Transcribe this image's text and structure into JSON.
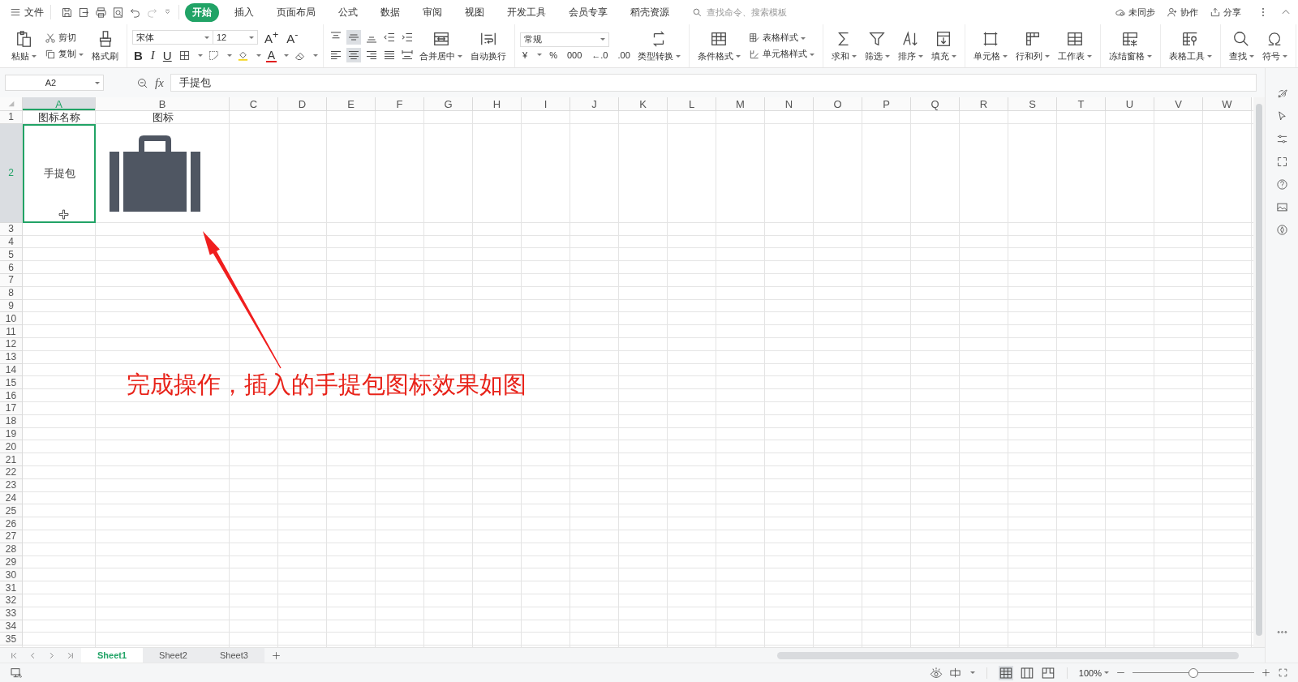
{
  "menu_bar": {
    "file_label": "文件",
    "tabs": [
      {
        "label": "开始",
        "selected": true
      },
      {
        "label": "插入",
        "selected": false
      },
      {
        "label": "页面布局",
        "selected": false
      },
      {
        "label": "公式",
        "selected": false
      },
      {
        "label": "数据",
        "selected": false
      },
      {
        "label": "审阅",
        "selected": false
      },
      {
        "label": "视图",
        "selected": false
      },
      {
        "label": "开发工具",
        "selected": false
      },
      {
        "label": "会员专享",
        "selected": false
      },
      {
        "label": "稻壳资源",
        "selected": false
      }
    ],
    "search": {
      "placeholder": "查找命令、搜索模板"
    },
    "actions": [
      "未同步",
      "协作",
      "分享"
    ]
  },
  "ribbon": {
    "groups": [
      [
        {
          "kind": "large",
          "label": "粘贴",
          "dropdown": true
        },
        {
          "kind": "stack",
          "items": [
            {
              "label": "剪切",
              "dropdown": false
            },
            {
              "label": "复制",
              "dropdown": true
            }
          ]
        },
        {
          "kind": "large",
          "label": "格式刷",
          "dropdown": false
        }
      ],
      [
        {
          "kind": "font",
          "name": "宋体",
          "size": "12",
          "grow": "A$^{+}$",
          "shrink": "A$^{-}$",
          "styles": [
            "B",
            "I",
            "U"
          ],
          "color_label": "A"
        }
      ],
      [
        {
          "kind": "align",
          "top": [
            {
              "selected": false
            },
            {
              "selected": true
            },
            {
              "selected": false
            },
            {
              "selected": false
            },
            {
              "selected": false
            }
          ],
          "bottom": [
            {
              "selected": false
            },
            {
              "selected": true
            },
            {
              "selected": false
            },
            {
              "selected": false
            },
            {
              "selected": false
            }
          ]
        },
        {
          "kind": "large",
          "label": "合并居中",
          "dropdown": true
        },
        {
          "kind": "large",
          "label": "自动换行",
          "dropdown": false
        }
      ],
      [
        {
          "kind": "number",
          "format": "常规",
          "buttons": [
            "¥",
            "%",
            "000",
            "←.0",
            ".00"
          ]
        },
        {
          "kind": "large",
          "label": "类型转换",
          "dropdown": true
        }
      ],
      [
        {
          "kind": "large",
          "label": "条件格式",
          "dropdown": true
        },
        {
          "kind": "stack",
          "items": [
            {
              "label": "表格样式",
              "dropdown": true
            },
            {
              "label": "单元格样式",
              "dropdown": true
            }
          ]
        }
      ],
      [
        {
          "kind": "large",
          "label": "求和",
          "dropdown": true
        },
        {
          "kind": "large",
          "label": "筛选",
          "dropdown": true
        },
        {
          "kind": "large",
          "label": "排序",
          "dropdown": true
        },
        {
          "kind": "large",
          "label": "填充",
          "dropdown": true
        }
      ],
      [
        {
          "kind": "large",
          "label": "单元格",
          "dropdown": true
        },
        {
          "kind": "large",
          "label": "行和列",
          "dropdown": true
        },
        {
          "kind": "large",
          "label": "工作表",
          "dropdown": true
        }
      ],
      [
        {
          "kind": "large",
          "label": "冻结窗格",
          "dropdown": true
        }
      ],
      [
        {
          "kind": "large",
          "label": "表格工具",
          "dropdown": true
        }
      ],
      [
        {
          "kind": "large",
          "label": "查找",
          "dropdown": true
        },
        {
          "kind": "large",
          "label": "符号",
          "dropdown": true
        }
      ]
    ]
  },
  "formula_bar": {
    "cell_ref": "A2",
    "fx": "fx",
    "value": "手提包"
  },
  "grid": {
    "columns": [
      {
        "label": "A",
        "selected": true
      },
      {
        "label": "B",
        "selected": false
      },
      {
        "label": "C",
        "selected": false
      },
      {
        "label": "D",
        "selected": false
      },
      {
        "label": "E",
        "selected": false
      },
      {
        "label": "F",
        "selected": false
      },
      {
        "label": "G",
        "selected": false
      },
      {
        "label": "H",
        "selected": false
      },
      {
        "label": "I",
        "selected": false
      },
      {
        "label": "J",
        "selected": false
      },
      {
        "label": "K",
        "selected": false
      },
      {
        "label": "L",
        "selected": false
      },
      {
        "label": "M",
        "selected": false
      },
      {
        "label": "N",
        "selected": false
      },
      {
        "label": "O",
        "selected": false
      },
      {
        "label": "P",
        "selected": false
      },
      {
        "label": "Q",
        "selected": false
      },
      {
        "label": "R",
        "selected": false
      },
      {
        "label": "S",
        "selected": false
      },
      {
        "label": "T",
        "selected": false
      },
      {
        "label": "U",
        "selected": false
      },
      {
        "label": "V",
        "selected": false
      },
      {
        "label": "W",
        "selected": false
      }
    ],
    "rows": [
      {
        "label": "1",
        "selected": false,
        "cells": [
          {
            "kind": "text",
            "text": "图标名称",
            "selected": false
          },
          {
            "kind": "text",
            "text": "图标",
            "selected": false
          }
        ]
      },
      {
        "label": "2",
        "selected": true,
        "cells": [
          {
            "kind": "text",
            "text": "手提包",
            "selected": true
          },
          {
            "kind": "icon",
            "selected": false
          }
        ]
      },
      {
        "label": "3",
        "selected": false
      },
      {
        "label": "4",
        "selected": false
      },
      {
        "label": "5",
        "selected": false
      },
      {
        "label": "6",
        "selected": false
      },
      {
        "label": "7",
        "selected": false
      },
      {
        "label": "8",
        "selected": false
      },
      {
        "label": "9",
        "selected": false
      },
      {
        "label": "10",
        "selected": false
      },
      {
        "label": "11",
        "selected": false
      },
      {
        "label": "12",
        "selected": false
      },
      {
        "label": "13",
        "selected": false
      },
      {
        "label": "14",
        "selected": false
      },
      {
        "label": "15",
        "selected": false
      },
      {
        "label": "16",
        "selected": false
      },
      {
        "label": "17",
        "selected": false
      },
      {
        "label": "18",
        "selected": false
      },
      {
        "label": "19",
        "selected": false
      },
      {
        "label": "20",
        "selected": false
      },
      {
        "label": "21",
        "selected": false
      },
      {
        "label": "22",
        "selected": false
      },
      {
        "label": "23",
        "selected": false
      },
      {
        "label": "24",
        "selected": false
      },
      {
        "label": "25",
        "selected": false
      },
      {
        "label": "26",
        "selected": false
      },
      {
        "label": "27",
        "selected": false
      },
      {
        "label": "28",
        "selected": false
      },
      {
        "label": "29",
        "selected": false
      },
      {
        "label": "30",
        "selected": false
      },
      {
        "label": "31",
        "selected": false
      },
      {
        "label": "32",
        "selected": false
      },
      {
        "label": "33",
        "selected": false
      },
      {
        "label": "34",
        "selected": false
      },
      {
        "label": "35",
        "selected": false
      }
    ]
  },
  "sheet_tabs": [
    {
      "label": "Sheet1",
      "selected": true
    },
    {
      "label": "Sheet2",
      "selected": false
    },
    {
      "label": "Sheet3",
      "selected": false
    }
  ],
  "status_bar": {
    "views": [
      {
        "selected": true
      },
      {
        "selected": false
      },
      {
        "selected": false
      }
    ],
    "zoom": "100%",
    "zoom_slider": {
      "level": 0.5
    }
  },
  "annotation": {
    "text": "完成操作，插入的手提包图标效果如图"
  }
}
